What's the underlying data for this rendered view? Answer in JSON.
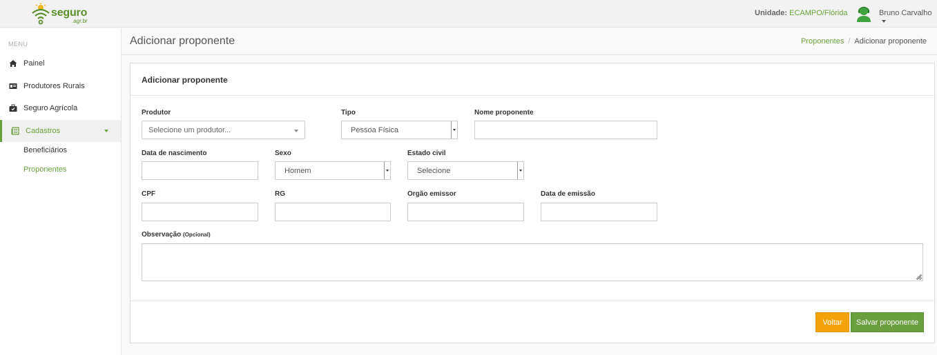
{
  "header": {
    "logo_text": "seguro",
    "logo_sub": ".agr.br",
    "unit_label": "Unidade:",
    "unit_value": "ECAMPO/Flórida",
    "user_name": "Bruno Carvalho"
  },
  "sidebar": {
    "menu_label": "MENU",
    "items": [
      {
        "label": "Painel",
        "icon": "home-icon"
      },
      {
        "label": "Produtores Rurais",
        "icon": "id-card-icon"
      },
      {
        "label": "Seguro Agrícola",
        "icon": "briefcase-icon"
      },
      {
        "label": "Cadastros",
        "icon": "book-icon",
        "active": true
      }
    ],
    "subitems": [
      {
        "label": "Beneficiários"
      },
      {
        "label": "Proponentes",
        "active": true
      }
    ]
  },
  "page": {
    "title": "Adicionar proponente",
    "breadcrumb": {
      "link": "Proponentes",
      "current": "Adicionar proponente"
    }
  },
  "form": {
    "card_title": "Adicionar proponente",
    "produtor": {
      "label": "Produtor",
      "placeholder": "Selecione um produtor..."
    },
    "tipo": {
      "label": "Tipo",
      "value": "Pessoa Física"
    },
    "nome": {
      "label": "Nome proponente",
      "value": ""
    },
    "nascimento": {
      "label": "Data de nascimento",
      "value": ""
    },
    "sexo": {
      "label": "Sexo",
      "value": "Homem"
    },
    "estado_civil": {
      "label": "Estado civil",
      "value": "Selecione"
    },
    "cpf": {
      "label": "CPF",
      "value": ""
    },
    "rg": {
      "label": "RG",
      "value": ""
    },
    "orgao": {
      "label": "Orgão emissor",
      "value": ""
    },
    "emissao": {
      "label": "Data de emissão",
      "value": ""
    },
    "observacao": {
      "label": "Observação",
      "optional": "(Opcional)",
      "value": ""
    },
    "back_label": "Voltar",
    "save_label": "Salvar proponente"
  },
  "colors": {
    "accent": "#6aa13b",
    "warning": "#f5a30a",
    "success": "#6b9e3f"
  }
}
